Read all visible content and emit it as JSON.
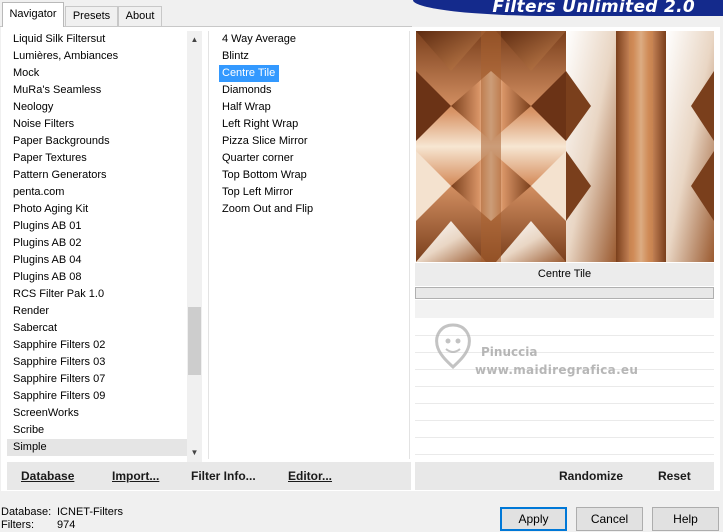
{
  "banner": {
    "title": "Filters Unlimited 2.0"
  },
  "tabs": [
    {
      "label": "Navigator",
      "active": true
    },
    {
      "label": "Presets",
      "active": false
    },
    {
      "label": "About",
      "active": false
    }
  ],
  "categories": {
    "items": [
      "Liquid Silk Filtersut",
      "Lumières, Ambiances",
      "Mock",
      "MuRa's Seamless",
      "Neology",
      "Noise Filters",
      "Paper Backgrounds",
      "Paper Textures",
      "Pattern Generators",
      "penta.com",
      "Photo Aging Kit",
      "Plugins AB 01",
      "Plugins AB 02",
      "Plugins AB 04",
      "Plugins AB 08",
      "RCS Filter Pak 1.0",
      "Render",
      "Sabercat",
      "Sapphire Filters 02",
      "Sapphire Filters 03",
      "Sapphire Filters 07",
      "Sapphire Filters 09",
      "ScreenWorks",
      "Scribe",
      "Simple"
    ],
    "selected": "Simple"
  },
  "filters": {
    "items": [
      "4 Way Average",
      "Blintz",
      "Centre Tile",
      "Diamonds",
      "Half Wrap",
      "Left Right Wrap",
      "Pizza Slice Mirror",
      "Quarter corner",
      "Top Bottom Wrap",
      "Top Left Mirror",
      "Zoom Out and Flip"
    ],
    "selected": "Centre Tile"
  },
  "preview": {
    "filter_name": "Centre Tile"
  },
  "watermark": {
    "name": "Pinuccia",
    "url": "www.maidiregrafica.eu"
  },
  "buttons": {
    "database": "Database",
    "import": "Import...",
    "filter_info": "Filter Info...",
    "editor": "Editor...",
    "randomize": "Randomize",
    "reset": "Reset",
    "apply": "Apply",
    "cancel": "Cancel",
    "help": "Help"
  },
  "status": {
    "database_label": "Database:",
    "database_value": "ICNET-Filters",
    "filters_label": "Filters:",
    "filters_value": "974"
  },
  "colors": {
    "banner": "#142a8c",
    "selection": "#3399ff",
    "preview_copper": "#c07a4e"
  }
}
